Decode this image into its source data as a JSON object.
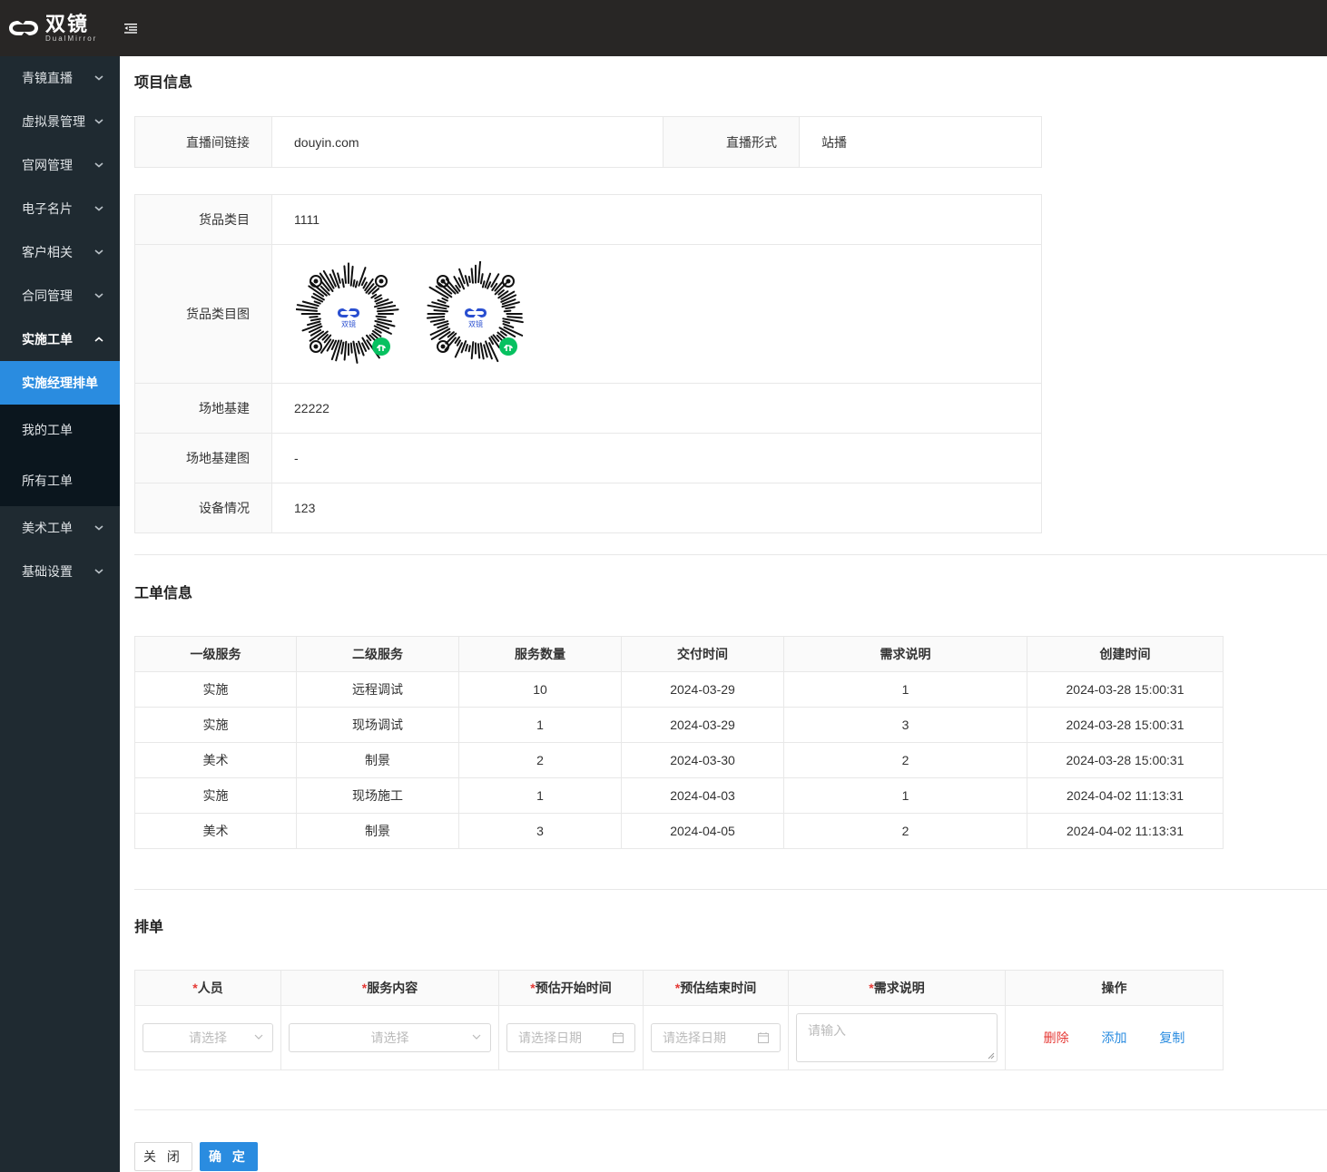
{
  "brand": {
    "name_cn": "双镜",
    "name_en": "DualMirror"
  },
  "sidebar": {
    "items_top": [
      {
        "label": "青镜直播"
      },
      {
        "label": "虚拟景管理"
      },
      {
        "label": "官网管理"
      },
      {
        "label": "电子名片"
      },
      {
        "label": "客户相关"
      },
      {
        "label": "合同管理"
      }
    ],
    "open_item": {
      "label": "实施工单"
    },
    "sub_items": [
      {
        "label": "实施经理排单",
        "active": true
      },
      {
        "label": "我的工单"
      },
      {
        "label": "所有工单"
      }
    ],
    "items_bottom": [
      {
        "label": "美术工单"
      },
      {
        "label": "基础设置"
      }
    ]
  },
  "project": {
    "title": "项目信息",
    "live_link_label": "直播间链接",
    "live_link_value": "douyin.com",
    "live_form_label": "直播形式",
    "live_form_value": "站播",
    "category_label": "货品类目",
    "category_value": "1111",
    "category_image_label": "货品类目图",
    "qr_logo_text": "双镜",
    "site_label": "场地基建",
    "site_value": "22222",
    "site_image_label": "场地基建图",
    "site_image_value": "-",
    "equipment_label": "设备情况",
    "equipment_value": "123"
  },
  "workorder": {
    "title": "工单信息",
    "columns": [
      "一级服务",
      "二级服务",
      "服务数量",
      "交付时间",
      "需求说明",
      "创建时间"
    ],
    "rows": [
      [
        "实施",
        "远程调试",
        "10",
        "2024-03-29",
        "1",
        "2024-03-28 15:00:31"
      ],
      [
        "实施",
        "现场调试",
        "1",
        "2024-03-29",
        "3",
        "2024-03-28 15:00:31"
      ],
      [
        "美术",
        "制景",
        "2",
        "2024-03-30",
        "2",
        "2024-03-28 15:00:31"
      ],
      [
        "实施",
        "现场施工",
        "1",
        "2024-04-03",
        "1",
        "2024-04-02 11:13:31"
      ],
      [
        "美术",
        "制景",
        "3",
        "2024-04-05",
        "2",
        "2024-04-02 11:13:31"
      ]
    ]
  },
  "schedule": {
    "title": "排单",
    "required_mark": "*",
    "col_person": "人员",
    "col_service": "服务内容",
    "col_start": "预估开始时间",
    "col_end": "预估结束时间",
    "col_req": "需求说明",
    "col_ops": "操作",
    "person_placeholder": "请选择",
    "service_placeholder": "请选择",
    "start_placeholder": "请选择日期",
    "end_placeholder": "请选择日期",
    "req_placeholder": "请输入",
    "delete_label": "删除",
    "add_label": "添加",
    "copy_label": "复制"
  },
  "footer": {
    "close_label": "关 闭",
    "ok_label": "确 定"
  },
  "colors": {
    "primary": "#2a8ce0",
    "danger": "#e53935",
    "sidebar_bg": "#1f2a31",
    "topbar_bg": "#282625"
  }
}
